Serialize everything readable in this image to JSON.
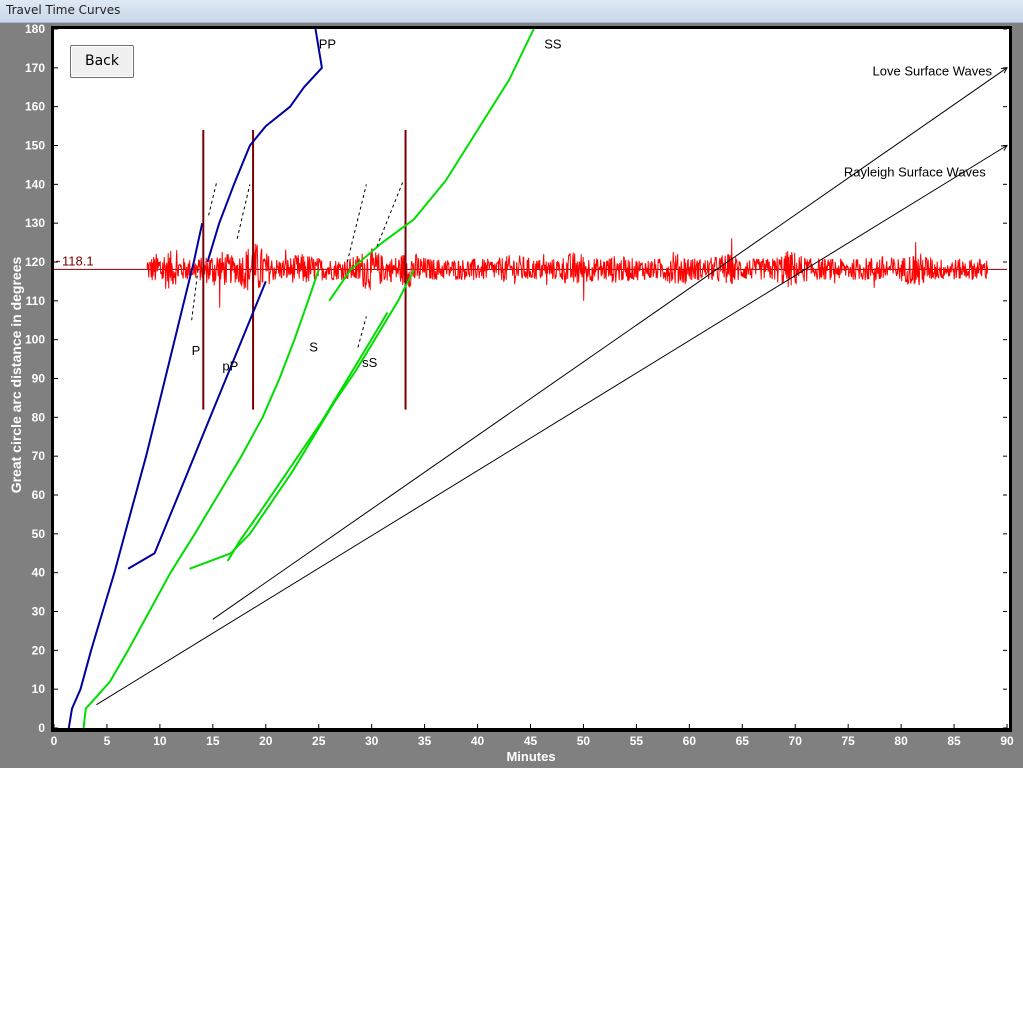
{
  "window": {
    "title": "Travel Time Curves"
  },
  "controls": {
    "back_label": "Back"
  },
  "colors": {
    "p_waves": "#0000a0",
    "s_waves": "#00dd00",
    "surface_waves": "#000000",
    "seismogram": "#ff0000",
    "markers": "#7a0000",
    "window_bg": "#808080"
  },
  "chart_data": {
    "type": "line",
    "title": "",
    "xlabel": "Minutes",
    "ylabel": "Great circle arc distance in degrees",
    "xlim": [
      0,
      90
    ],
    "ylim": [
      0,
      180
    ],
    "x_ticks": [
      0,
      5,
      10,
      15,
      20,
      25,
      30,
      35,
      40,
      45,
      50,
      55,
      60,
      65,
      70,
      75,
      80,
      85,
      90
    ],
    "y_ticks": [
      0,
      10,
      20,
      30,
      40,
      50,
      60,
      70,
      80,
      90,
      100,
      110,
      120,
      130,
      140,
      150,
      160,
      170,
      180
    ],
    "grid": false,
    "series": [
      {
        "name": "P",
        "color": "#0000a0",
        "points": [
          [
            1.4,
            0
          ],
          [
            1.7,
            5
          ],
          [
            2.5,
            10
          ],
          [
            3.5,
            20
          ],
          [
            4.6,
            30
          ],
          [
            5.7,
            40
          ],
          [
            6.7,
            50
          ],
          [
            7.7,
            60
          ],
          [
            8.7,
            70
          ],
          [
            9.6,
            80
          ],
          [
            10.5,
            90
          ],
          [
            11.4,
            100
          ],
          [
            12.3,
            110
          ],
          [
            13.2,
            120
          ],
          [
            14.0,
            130
          ]
        ]
      },
      {
        "name": "PP",
        "color": "#0000a0",
        "points": [
          [
            14.5,
            120
          ],
          [
            15.6,
            130
          ],
          [
            17.0,
            140
          ],
          [
            18.5,
            150
          ],
          [
            20,
            155
          ],
          [
            22.3,
            160
          ],
          [
            23.6,
            165
          ],
          [
            25.3,
            170
          ],
          [
            24.7,
            180
          ]
        ]
      },
      {
        "name": "pP",
        "color": "#0000a0",
        "points": [
          [
            7.0,
            41
          ],
          [
            9.5,
            45
          ],
          [
            11.0,
            55
          ],
          [
            12.5,
            65
          ],
          [
            14.0,
            75
          ],
          [
            15.5,
            85
          ],
          [
            17.0,
            95
          ],
          [
            18.5,
            105
          ],
          [
            20.0,
            115
          ]
        ]
      },
      {
        "name": "S",
        "color": "#00dd00",
        "points": [
          [
            2.8,
            0
          ],
          [
            3.0,
            5
          ],
          [
            4.0,
            8
          ],
          [
            5.3,
            12
          ],
          [
            7.0,
            20
          ],
          [
            9.0,
            30
          ],
          [
            11.0,
            40
          ],
          [
            13.3,
            50
          ],
          [
            15.5,
            60
          ],
          [
            17.7,
            70
          ],
          [
            19.7,
            80
          ],
          [
            21.3,
            90
          ],
          [
            22.7,
            100
          ],
          [
            24.0,
            110
          ],
          [
            25.0,
            118
          ]
        ]
      },
      {
        "name": "SS",
        "color": "#00dd00",
        "points": [
          [
            26,
            110
          ],
          [
            28,
            118
          ],
          [
            31,
            125
          ],
          [
            34,
            131
          ],
          [
            37,
            141
          ],
          [
            40,
            154
          ],
          [
            43,
            167
          ],
          [
            45.3,
            180
          ]
        ]
      },
      {
        "name": "sS",
        "color": "#00dd00",
        "points": [
          [
            12.8,
            41
          ],
          [
            16.7,
            45
          ],
          [
            18.5,
            50
          ],
          [
            20.5,
            58
          ],
          [
            22.5,
            66
          ],
          [
            24.5,
            75
          ],
          [
            26.5,
            84
          ],
          [
            28.5,
            92
          ],
          [
            30.5,
            101
          ],
          [
            32.5,
            110
          ],
          [
            34,
            118
          ]
        ]
      },
      {
        "name": "sS",
        "color": "#00dd00",
        "points": [
          [
            16.4,
            43
          ],
          [
            17.5,
            48
          ],
          [
            19.3,
            55
          ],
          [
            21.3,
            63
          ],
          [
            23.3,
            71
          ],
          [
            25.3,
            79
          ],
          [
            27.3,
            88
          ],
          [
            29.3,
            97
          ],
          [
            31.5,
            107
          ]
        ]
      },
      {
        "name": "Love Surface Waves",
        "color": "#000000",
        "points": [
          [
            15.0,
            28
          ],
          [
            90,
            170
          ]
        ]
      },
      {
        "name": "Rayleigh Surface Waves",
        "color": "#000000",
        "points": [
          [
            4.0,
            6
          ],
          [
            90,
            150
          ]
        ]
      }
    ],
    "annotations": [
      {
        "text": "PP",
        "x": 25.0,
        "y": 175
      },
      {
        "text": "SS",
        "x": 46.3,
        "y": 175
      },
      {
        "text": "Love Surface Waves",
        "x": 77.3,
        "y": 168
      },
      {
        "text": "Rayleigh Surface Waves",
        "x": 74.6,
        "y": 142
      },
      {
        "text": "P",
        "x": 13.0,
        "y": 96
      },
      {
        "text": "pP",
        "x": 15.9,
        "y": 92
      },
      {
        "text": "S",
        "x": 24.1,
        "y": 97
      },
      {
        "text": "sS",
        "x": 29.1,
        "y": 93
      }
    ],
    "dashed_segments": [
      [
        [
          13.0,
          105
        ],
        [
          13.6,
          118
        ]
      ],
      [
        [
          14.6,
          132
        ],
        [
          15.4,
          141
        ]
      ],
      [
        [
          17.3,
          126
        ],
        [
          18.5,
          140
        ]
      ],
      [
        [
          27.7,
          120
        ],
        [
          29.5,
          140
        ]
      ],
      [
        [
          30.5,
          124
        ],
        [
          33.0,
          141
        ]
      ],
      [
        [
          28.7,
          98
        ],
        [
          29.5,
          106
        ]
      ]
    ],
    "seismogram": {
      "distance": 118.1,
      "label": "118.1",
      "start_minutes": 8.8,
      "end_minutes": 88.2,
      "typical_amplitude_degrees": 5,
      "max_amplitude_degrees": 24
    },
    "markers_minutes": [
      14.1,
      18.8,
      33.2
    ],
    "marker_range_degrees": [
      82,
      154
    ]
  }
}
